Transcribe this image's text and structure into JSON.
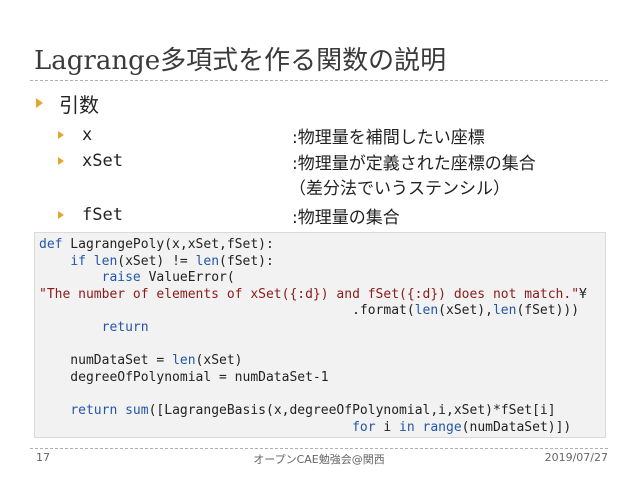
{
  "slide": {
    "title": "Lagrange多項式を作る関数の説明",
    "bullet": "引数",
    "params": [
      {
        "name": "x",
        "desc": ":物理量を補間したい座標"
      },
      {
        "name": "xSet",
        "desc": ":物理量が定義された座標の集合",
        "desc_cont": "（差分法でいうステンシル）"
      },
      {
        "name": "fSet",
        "desc": ":物理量の集合"
      }
    ]
  },
  "code": {
    "lines": [
      "def LagrangePoly(x,xSet,fSet):",
      "    if len(xSet) != len(fSet):",
      "        raise ValueError(",
      "\"The number of elements of xSet({:d}) and fSet({:d}) does not match.\"¥",
      "                                        .format(len(xSet),len(fSet)))",
      "        return",
      "",
      "    numDataSet = len(xSet)",
      "    degreeOfPolynomial = numDataSet-1",
      "",
      "    return sum([LagrangeBasis(x,degreeOfPolynomial,i,xSet)*fSet[i]",
      "                                        for i in range(numDataSet)])"
    ],
    "keywords": [
      "def",
      "if",
      "raise",
      "return",
      "for",
      "in",
      "len",
      "range",
      "sum"
    ]
  },
  "footer": {
    "page": "17",
    "center": "オープンCAE勉強会@関西",
    "date": "2019/07/27"
  }
}
